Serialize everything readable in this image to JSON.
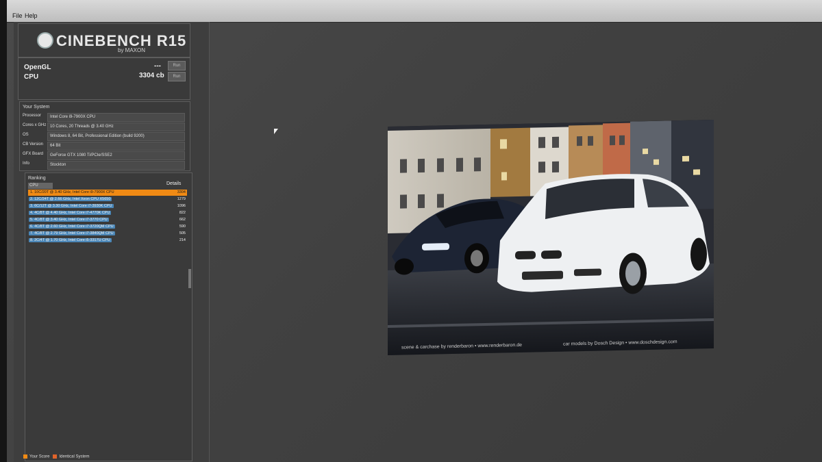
{
  "menubar": {
    "items": [
      "File",
      "Help"
    ]
  },
  "logo": {
    "title": "CINEBENCH R15",
    "subtitle": "by MAXON"
  },
  "scores": {
    "opengl_label": "OpenGL",
    "opengl_value": "---",
    "cpu_label": "CPU",
    "cpu_value": "3304 cb",
    "run_label": "Run"
  },
  "system": {
    "title": "Your System",
    "rows": [
      {
        "k": "Processor",
        "v": "Intel Core i9-7900X CPU"
      },
      {
        "k": "Cores x GHz",
        "v": "10 Cores, 20 Threads @ 3.40 GHz"
      },
      {
        "k": "OS",
        "v": "Windows 8, 64 Bit, Professional Edition (build 9200)"
      },
      {
        "k": "CB Version",
        "v": "64 Bit"
      },
      {
        "k": "GFX Board",
        "v": "GeForce GTX 1080 Ti/PCIe/SSE2"
      },
      {
        "k": "Info",
        "v": "Stockton"
      }
    ]
  },
  "ranking": {
    "title": "Ranking",
    "select_value": "CPU",
    "details_label": "Details",
    "rows": [
      {
        "label": "1. 10C/20T @ 3.40 GHz, Intel Core i9-7900X CPU",
        "value": "3304",
        "active": true
      },
      {
        "label": "2. 12C/24T @ 2.66 GHz, Intel Xeon CPU X5650",
        "value": "1279",
        "active": false
      },
      {
        "label": "3. 6C/12T @ 3.30 GHz, Intel Core i7-3930K CPU",
        "value": "1096",
        "active": false
      },
      {
        "label": "4. 4C/8T @ 4.40 GHz, Intel Core i7-4770K CPU",
        "value": "822",
        "active": false
      },
      {
        "label": "5. 4C/8T @ 3.40 GHz, Intel Core i7-3770 CPU",
        "value": "662",
        "active": false
      },
      {
        "label": "6. 4C/8T @ 2.60 GHz, Intel Core i7-3720QM CPU",
        "value": "590",
        "active": false
      },
      {
        "label": "7. 4C/8T @ 2.79 GHz, Intel Core i7-3840QM CPU",
        "value": "505",
        "active": false
      },
      {
        "label": "8. 2C/4T @ 1.70 GHz, Intel Core i5-3317U CPU",
        "value": "214",
        "active": false
      }
    ]
  },
  "legend": {
    "your_score": "Your Score",
    "identical_system": "Identical System"
  },
  "render": {
    "credit_left": "scene & carchase by renderbaron • www.renderbaron.de",
    "credit_right": "car models by Dosch Design • www.doschdesign.com"
  },
  "colors": {
    "active_row": "#f08a14",
    "rank_bar": "#4b87b8",
    "identical_swatch": "#e0632a"
  }
}
